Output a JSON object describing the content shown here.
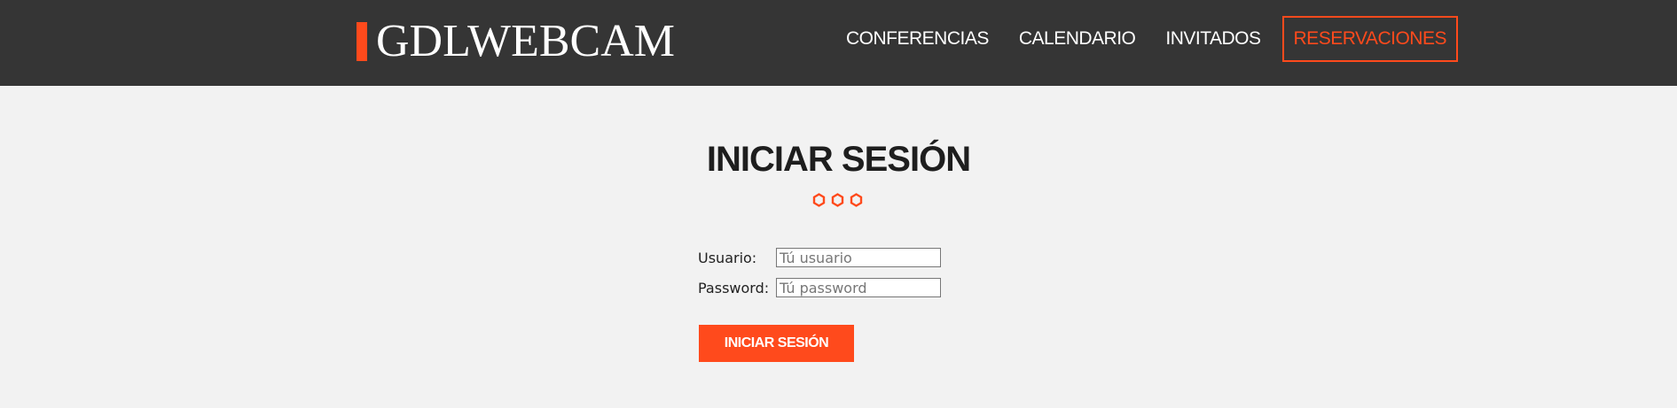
{
  "colors": {
    "accent": "#ff4a1c",
    "header_bg": "#353535",
    "page_bg": "#f2f2f2"
  },
  "header": {
    "logo_text": "GDLWEBCAM",
    "nav": [
      {
        "label": "CONFERENCIAS",
        "active": false
      },
      {
        "label": "CALENDARIO",
        "active": false
      },
      {
        "label": "INVITADOS",
        "active": false
      },
      {
        "label": "RESERVACIONES",
        "active": true
      }
    ]
  },
  "main": {
    "title": "INICIAR SESIÓN",
    "decoration_icon": "hexagon-icon",
    "form": {
      "user_label": "Usuario:",
      "user_placeholder": "Tú usuario",
      "user_value": "",
      "password_label": "Password:",
      "password_placeholder": "Tú password",
      "password_value": "",
      "submit_label": "INICIAR SESIÓN"
    }
  }
}
